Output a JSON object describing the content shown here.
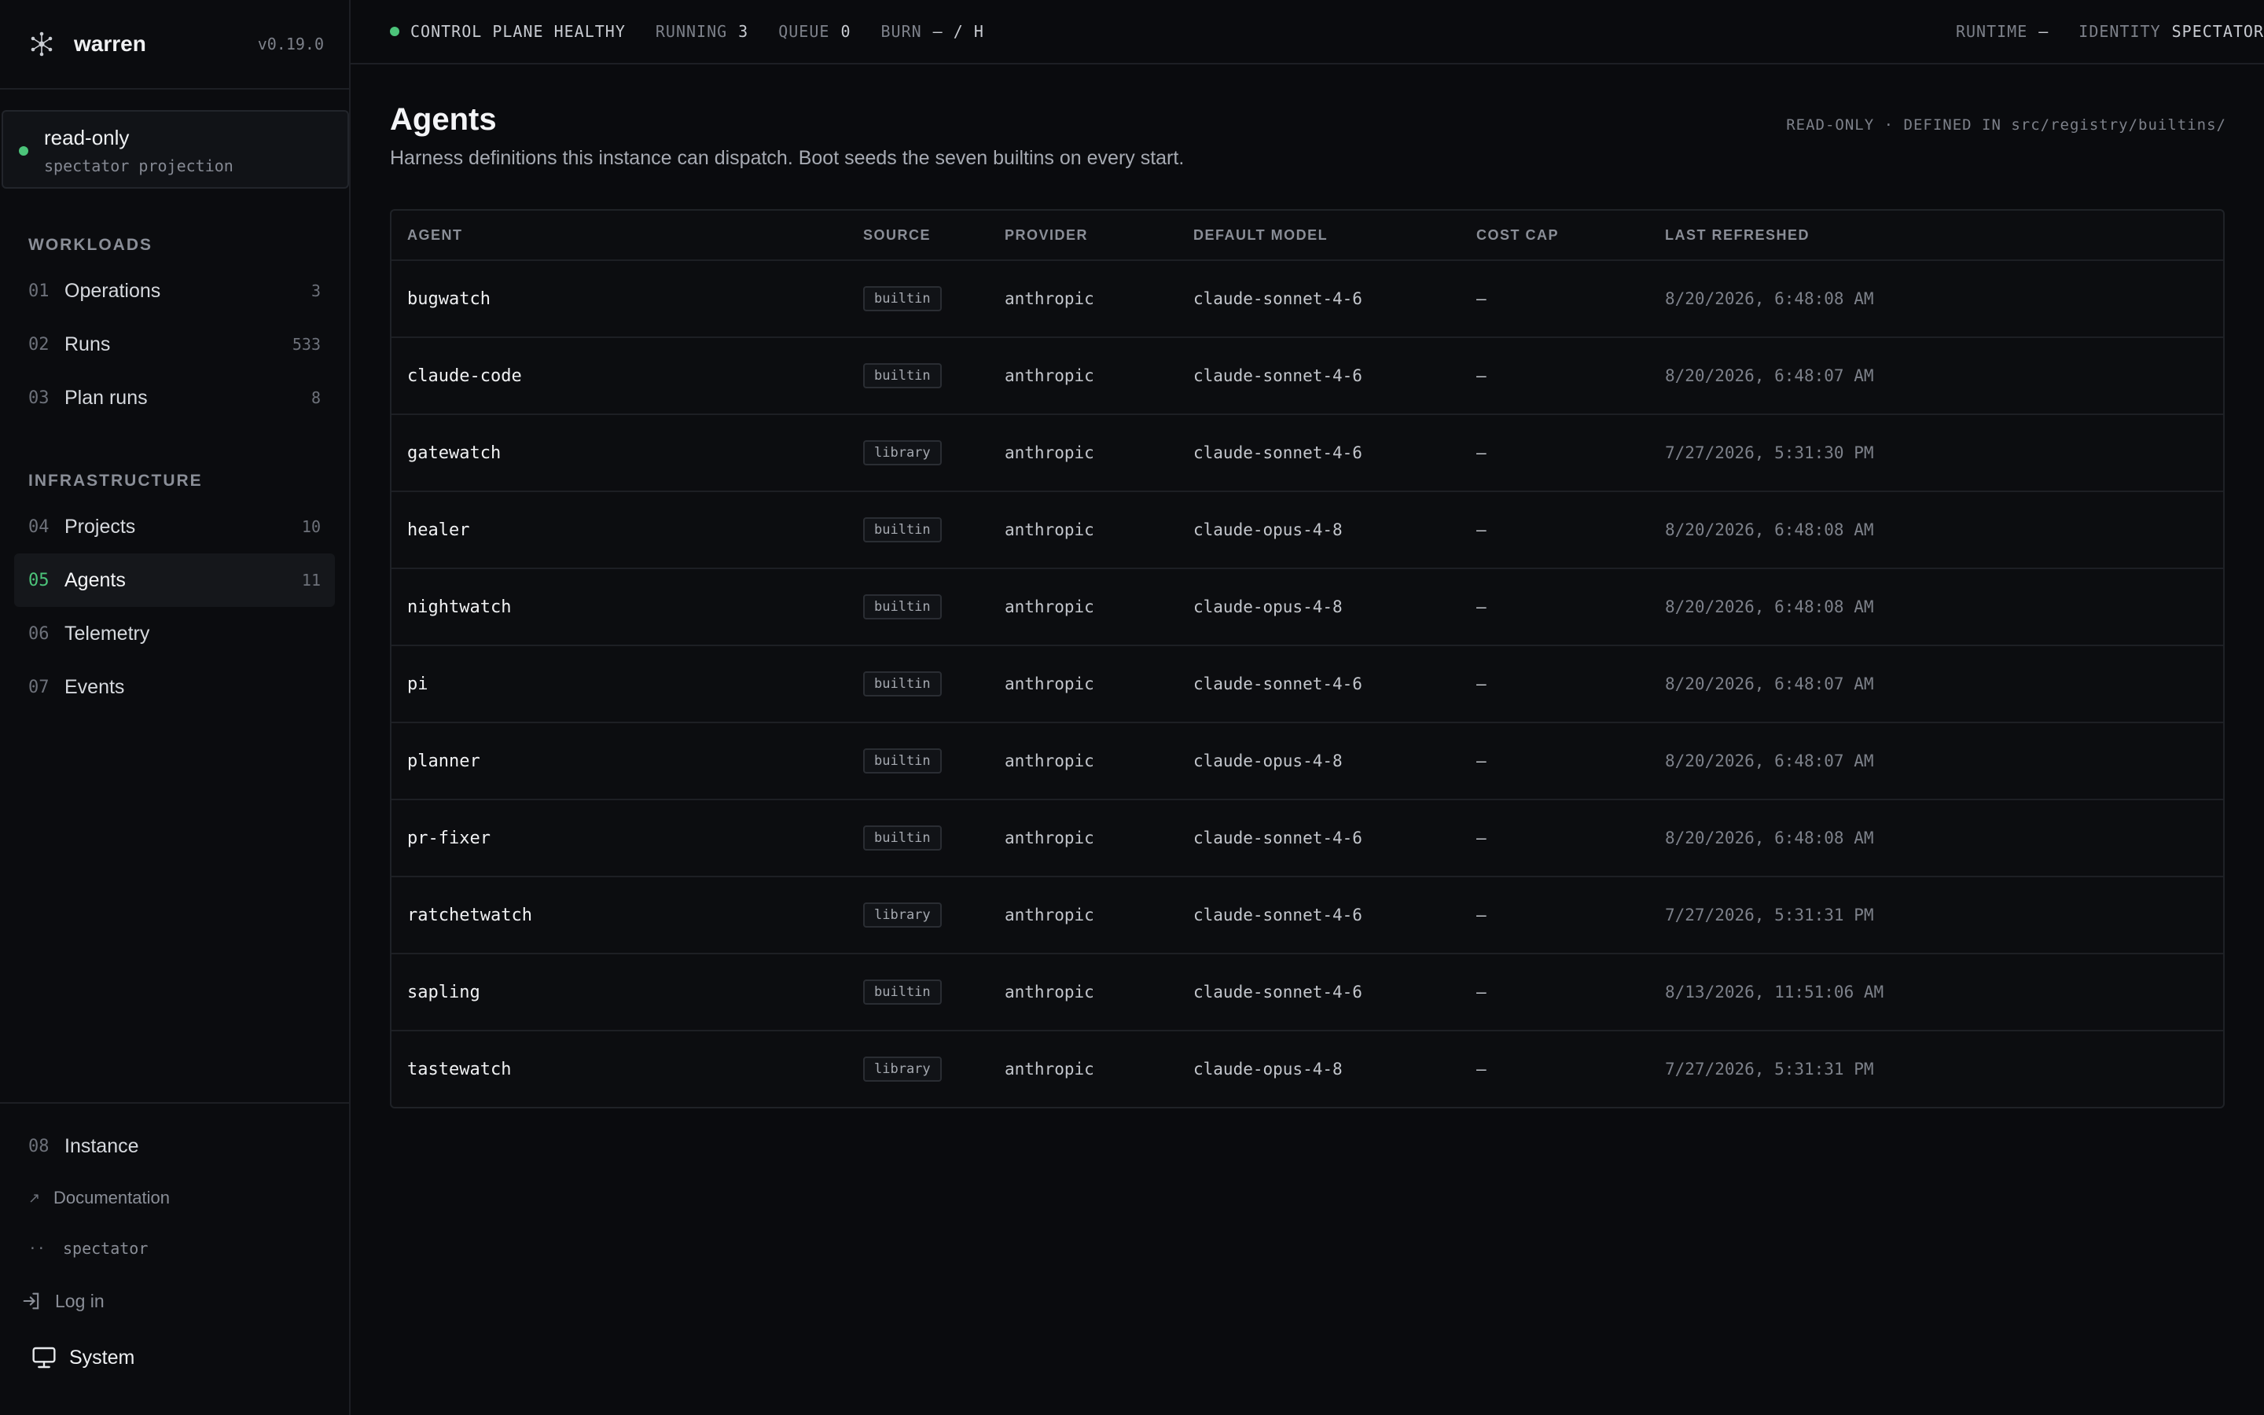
{
  "brand": {
    "name": "warren",
    "version": "v0.19.0"
  },
  "mode": {
    "title": "read-only",
    "subtitle": "spectator projection"
  },
  "sidebar": {
    "workloads_label": "WORKLOADS",
    "infrastructure_label": "INFRASTRUCTURE",
    "workloads": [
      {
        "num": "01",
        "label": "Operations",
        "count": "3"
      },
      {
        "num": "02",
        "label": "Runs",
        "count": "533"
      },
      {
        "num": "03",
        "label": "Plan runs",
        "count": "8"
      }
    ],
    "infrastructure": [
      {
        "num": "04",
        "label": "Projects",
        "count": "10"
      },
      {
        "num": "05",
        "label": "Agents",
        "count": "11"
      },
      {
        "num": "06",
        "label": "Telemetry",
        "count": ""
      },
      {
        "num": "07",
        "label": "Events",
        "count": ""
      }
    ],
    "instance": {
      "num": "08",
      "label": "Instance"
    },
    "documentation": "Documentation",
    "user": "spectator",
    "login": "Log in",
    "theme": "System"
  },
  "topbar": {
    "health": "CONTROL PLANE HEALTHY",
    "running_label": "RUNNING",
    "running_value": "3",
    "queue_label": "QUEUE",
    "queue_value": "0",
    "burn_label": "BURN",
    "burn_value": "— / H",
    "runtime_label": "RUNTIME",
    "runtime_value": "—",
    "identity_label": "IDENTITY",
    "identity_value": "SPECTATOR"
  },
  "page": {
    "title": "Agents",
    "description": "Harness definitions this instance can dispatch. Boot seeds the seven builtins on every start.",
    "meta": "READ-ONLY · DEFINED IN src/registry/builtins/"
  },
  "table": {
    "headers": [
      "AGENT",
      "SOURCE",
      "PROVIDER",
      "DEFAULT MODEL",
      "COST CAP",
      "LAST REFRESHED"
    ],
    "rows": [
      {
        "agent": "bugwatch",
        "source": "builtin",
        "provider": "anthropic",
        "model": "claude-sonnet-4-6",
        "cost_cap": "—",
        "refreshed": "8/20/2026, 6:48:08 AM"
      },
      {
        "agent": "claude-code",
        "source": "builtin",
        "provider": "anthropic",
        "model": "claude-sonnet-4-6",
        "cost_cap": "—",
        "refreshed": "8/20/2026, 6:48:07 AM"
      },
      {
        "agent": "gatewatch",
        "source": "library",
        "provider": "anthropic",
        "model": "claude-sonnet-4-6",
        "cost_cap": "—",
        "refreshed": "7/27/2026, 5:31:30 PM"
      },
      {
        "agent": "healer",
        "source": "builtin",
        "provider": "anthropic",
        "model": "claude-opus-4-8",
        "cost_cap": "—",
        "refreshed": "8/20/2026, 6:48:08 AM"
      },
      {
        "agent": "nightwatch",
        "source": "builtin",
        "provider": "anthropic",
        "model": "claude-opus-4-8",
        "cost_cap": "—",
        "refreshed": "8/20/2026, 6:48:08 AM"
      },
      {
        "agent": "pi",
        "source": "builtin",
        "provider": "anthropic",
        "model": "claude-sonnet-4-6",
        "cost_cap": "—",
        "refreshed": "8/20/2026, 6:48:07 AM"
      },
      {
        "agent": "planner",
        "source": "builtin",
        "provider": "anthropic",
        "model": "claude-opus-4-8",
        "cost_cap": "—",
        "refreshed": "8/20/2026, 6:48:07 AM"
      },
      {
        "agent": "pr-fixer",
        "source": "builtin",
        "provider": "anthropic",
        "model": "claude-sonnet-4-6",
        "cost_cap": "—",
        "refreshed": "8/20/2026, 6:48:08 AM"
      },
      {
        "agent": "ratchetwatch",
        "source": "library",
        "provider": "anthropic",
        "model": "claude-sonnet-4-6",
        "cost_cap": "—",
        "refreshed": "7/27/2026, 5:31:31 PM"
      },
      {
        "agent": "sapling",
        "source": "builtin",
        "provider": "anthropic",
        "model": "claude-sonnet-4-6",
        "cost_cap": "—",
        "refreshed": "8/13/2026, 11:51:06 AM"
      },
      {
        "agent": "tastewatch",
        "source": "library",
        "provider": "anthropic",
        "model": "claude-opus-4-8",
        "cost_cap": "—",
        "refreshed": "7/27/2026, 5:31:31 PM"
      }
    ]
  },
  "colors": {
    "accent": "#4cc47a",
    "background": "#0a0b0e",
    "border": "#1d1f24"
  },
  "icons": {
    "brand": "network-hub-icon",
    "docs": "external-link-icon",
    "user": "user-dots-icon",
    "login": "login-icon",
    "theme": "monitor-icon"
  }
}
